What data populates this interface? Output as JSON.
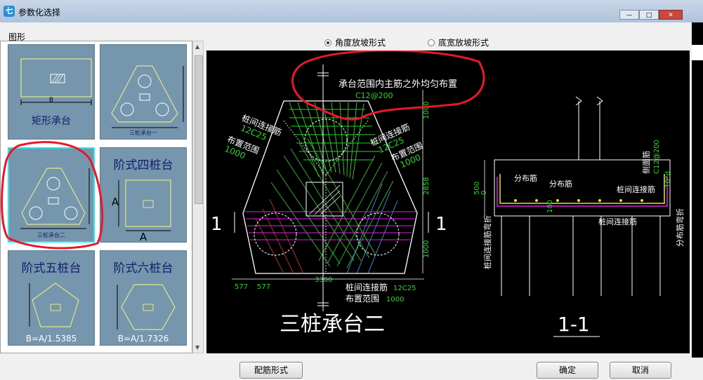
{
  "window": {
    "title": "参数化选择",
    "min_glyph": "—",
    "max_glyph": "□",
    "close_glyph": "✕"
  },
  "left_panel": {
    "group_label": "图形",
    "thumbnails": [
      {
        "label": "矩形承台",
        "dim_text": "B",
        "selected": false
      },
      {
        "label": "三桩承台一",
        "dim_text": "",
        "selected": false
      },
      {
        "label": "三桩承台二",
        "dim_text": "",
        "selected": true
      },
      {
        "label": "阶式四桩台",
        "dim_text": "A",
        "selected": false
      },
      {
        "label": "阶式五桩台",
        "dim_text": "B=A/1.5385",
        "selected": false
      },
      {
        "label": "阶式六桩台",
        "dim_text": "B=A/1.7326",
        "selected": false
      }
    ]
  },
  "slope_options": [
    {
      "label": "角度放坡形式",
      "selected": true
    },
    {
      "label": "底宽放坡形式",
      "selected": false
    }
  ],
  "drawing": {
    "annotation_top": "承台范围内主筋之外均匀布置",
    "rebar_top": "C12@200",
    "left_label_1": "桩间连接筋",
    "left_label_2": "12C25",
    "left_label_3": "布置范围",
    "left_label_4": "1000",
    "right_label_1": "桩间连接筋",
    "right_label_2": "12C25",
    "right_label_3": "布置范围",
    "right_label_4": "1000",
    "dim_top": "1000",
    "dim_mid": "2858",
    "dim_bot": "1000",
    "dim_577a": "577",
    "dim_577b": "577",
    "dim_3300": "3300",
    "bottom_label_1": "桩间连接筋",
    "bottom_rebar": "12C25",
    "bottom_label_2": "布置范围",
    "bottom_range": "1000",
    "section_mark": "1",
    "title": "三桩承台二",
    "section_title": "1-1",
    "sec_fenbu1": "分布筋",
    "sec_fenbu2": "分布筋",
    "sec_side": "侧面筋",
    "sec_side_rebar": "C12@200",
    "sec_zhuangjian1": "桩间连接筋",
    "sec_zhuangjian2": "桩间连接筋",
    "sec_zhuangjian3": "桩间连接筋弯折",
    "sec_fenbu_bend": "分布筋弯折",
    "sec_10d": "10*d",
    "sec_500": "500",
    "sec_0": "0",
    "sec_100": "100"
  },
  "buttons": {
    "rebar_form": "配筋形式",
    "ok": "确定",
    "cancel": "取消"
  },
  "colors": {
    "canvas_bg": "#000000",
    "thumb_bg": "#7596ad",
    "selection_border": "#2ee6f0",
    "annotation_red": "#e8182a",
    "cad_green": "#22d822",
    "cad_white": "#ffffff",
    "cad_magenta": "#e020e0",
    "cad_yellow": "#e6e62a"
  }
}
